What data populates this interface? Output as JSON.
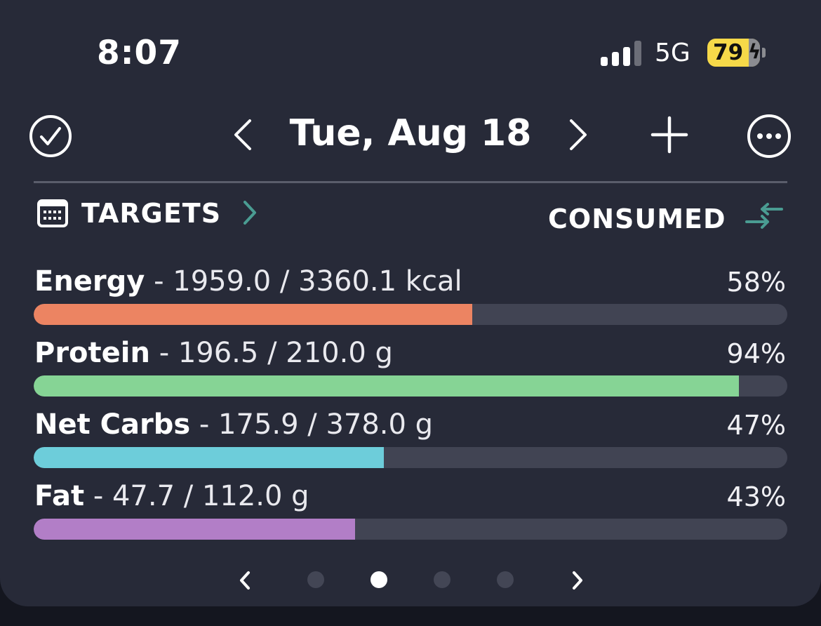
{
  "status_bar": {
    "time": "8:07",
    "network": "5G",
    "battery_percent": "79",
    "battery_level": 0.79
  },
  "header": {
    "date": "Tue, Aug 18"
  },
  "section": {
    "targets_label": "TARGETS",
    "consumed_label": "CONSUMED"
  },
  "nutrients": [
    {
      "name": "Energy",
      "amount": "- 1959.0 / 3360.1 kcal",
      "percent_label": "58%",
      "fraction": 0.582,
      "color": "#ec8462"
    },
    {
      "name": "Protein",
      "amount": "- 196.5 / 210.0 g",
      "percent_label": "94%",
      "fraction": 0.936,
      "color": "#86d495"
    },
    {
      "name": "Net Carbs",
      "amount": "- 175.9 / 378.0 g",
      "percent_label": "47%",
      "fraction": 0.465,
      "color": "#6dcdda"
    },
    {
      "name": "Fat",
      "amount": "- 47.7 / 112.0 g",
      "percent_label": "43%",
      "fraction": 0.426,
      "color": "#b27ec7"
    }
  ],
  "pager": {
    "page_count": 4,
    "active_index": 1
  },
  "colors": {
    "accent_teal": "#4a9c92",
    "background": "#272a38",
    "track": "#414453"
  },
  "icons": [
    "check-circle-icon",
    "chevron-left-icon",
    "chevron-right-icon",
    "plus-icon",
    "more-icon",
    "calendar-icon",
    "swap-icon"
  ]
}
